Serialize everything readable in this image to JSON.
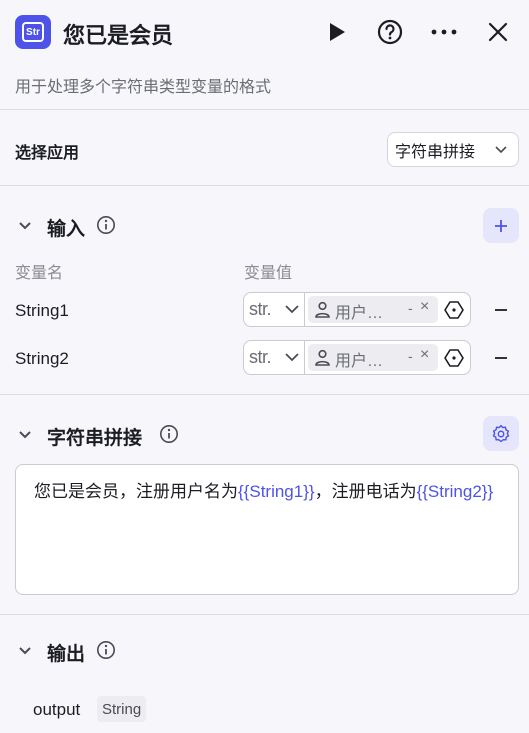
{
  "header": {
    "app_icon_text": "Str",
    "title": "您已是会员",
    "description": "用于处理多个字符串类型变量的格式"
  },
  "select_app": {
    "label": "选择应用",
    "value": "字符串拼接"
  },
  "input_section": {
    "title": "输入",
    "col_name": "变量名",
    "col_value": "变量值",
    "variables": [
      {
        "name": "String1",
        "type": "str.",
        "ref": "用户…",
        "ref_dash": "-",
        "ref_x": "×"
      },
      {
        "name": "String2",
        "type": "str.",
        "ref": "用户…",
        "ref_dash": "-",
        "ref_x": "×"
      }
    ]
  },
  "concat_section": {
    "title": "字符串拼接",
    "text_parts": {
      "p1": "您已是会员，注册用户名为",
      "v1": "{{String1}}",
      "p2": "，注册电话为",
      "v2": "{{String2}}"
    }
  },
  "output_section": {
    "title": "输出",
    "name": "output",
    "type": "String"
  },
  "colors": {
    "accent": "#4d53e8",
    "accent_light": "#e5e6fb",
    "background": "#f7f7fb"
  }
}
